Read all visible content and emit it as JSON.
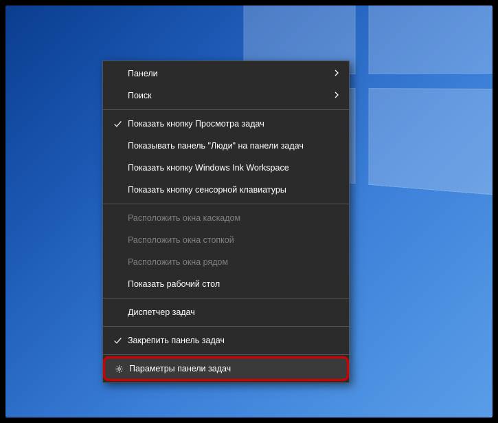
{
  "menu": {
    "items": [
      {
        "label": "Панели",
        "hasSubmenu": true
      },
      {
        "label": "Поиск",
        "hasSubmenu": true
      },
      {
        "separator": true
      },
      {
        "label": "Показать кнопку Просмотра задач",
        "checked": true
      },
      {
        "label": "Показывать панель \"Люди\" на панели задач"
      },
      {
        "label": "Показать кнопку Windows Ink Workspace"
      },
      {
        "label": "Показать кнопку сенсорной клавиатуры"
      },
      {
        "separator": true
      },
      {
        "label": "Расположить окна каскадом",
        "disabled": true
      },
      {
        "label": "Расположить окна стопкой",
        "disabled": true
      },
      {
        "label": "Расположить окна рядом",
        "disabled": true
      },
      {
        "label": "Показать рабочий стол"
      },
      {
        "separator": true
      },
      {
        "label": "Диспетчер задач"
      },
      {
        "separator": true
      },
      {
        "label": "Закрепить панель задач",
        "checked": true
      },
      {
        "separator": true
      },
      {
        "label": "Параметры панели задач",
        "icon": "gear",
        "highlighted": true
      }
    ]
  }
}
